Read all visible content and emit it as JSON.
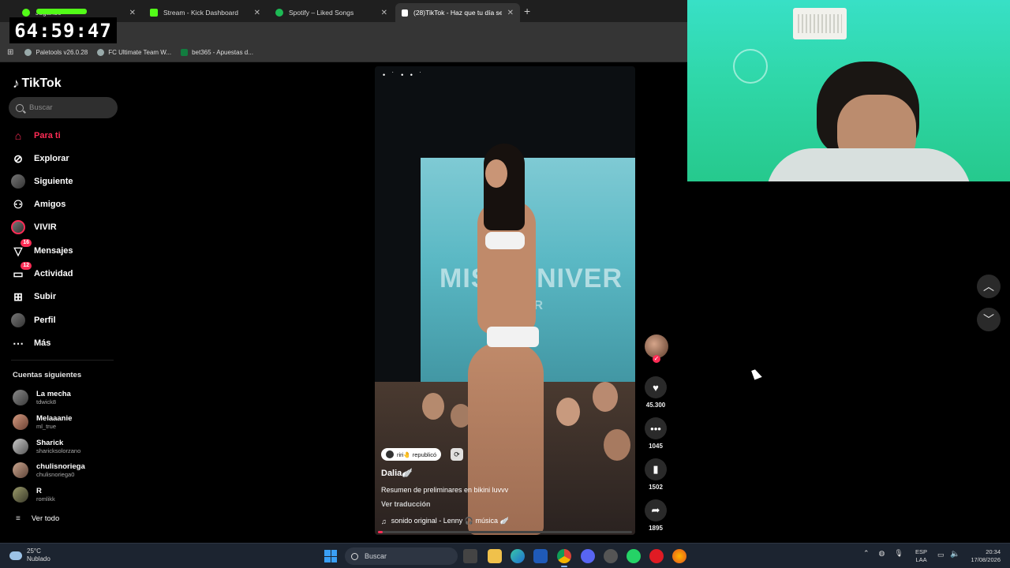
{
  "browser": {
    "tabs": [
      {
        "label": "Jugando",
        "color": "#53fc18",
        "active": false
      },
      {
        "label": "Stream - Kick Dashboard",
        "color": "#53fc18",
        "active": false
      },
      {
        "label": "Spotify – Liked Songs",
        "color": "#1db954",
        "active": false
      },
      {
        "label": "(28)TikTok - Haz que tu día sea",
        "color": "#ffffff",
        "active": true
      }
    ],
    "timer": "64:59:47",
    "bookmarks": [
      {
        "label": "Paletools v26.0.28"
      },
      {
        "label": "FC Ultimate Team W..."
      },
      {
        "label": "bet365 - Apuestas d..."
      }
    ]
  },
  "tiktok": {
    "logo": "TikTok",
    "search_placeholder": "Buscar",
    "nav": [
      {
        "label": "Para ti",
        "icon": "home-icon"
      },
      {
        "label": "Explorar",
        "icon": "compass-icon"
      },
      {
        "label": "Siguiente",
        "icon": "following-icon"
      },
      {
        "label": "Amigos",
        "icon": "friends-icon"
      },
      {
        "label": "VIVIR",
        "icon": "live-icon"
      },
      {
        "label": "Mensajes",
        "icon": "messages-icon",
        "badge": "16"
      },
      {
        "label": "Actividad",
        "icon": "activity-icon",
        "badge": "12"
      },
      {
        "label": "Subir",
        "icon": "upload-icon"
      },
      {
        "label": "Perfil",
        "icon": "profile-icon"
      },
      {
        "label": "Más",
        "icon": "more-icon"
      }
    ],
    "following_title": "Cuentas siguientes",
    "following": [
      {
        "name": "La mecha",
        "handle": "tdwick8"
      },
      {
        "name": "Melaaanie",
        "handle": "ml_true"
      },
      {
        "name": "Sharick",
        "handle": "sharicksolorzano"
      },
      {
        "name": "chulisnoriega",
        "handle": "chulisnoriega0"
      },
      {
        "name": "R",
        "handle": "romlikk"
      }
    ],
    "see_all": "Ver todo",
    "video": {
      "screen_text": "MISS UNIVER",
      "screen_text2": "ADOR",
      "repost_label": "riri🤚 republicó",
      "author": "Dalia🪽",
      "caption": "Resumen de preliminares en bikini luvvv",
      "translate": "Ver traducción",
      "sound": "sonido original - Lenny 🎧 música 🪽",
      "progress": 0.02
    },
    "actions": {
      "likes": "45.300",
      "comments": "1045",
      "saves": "1502",
      "shares": "1895"
    }
  },
  "taskbar": {
    "weather_temp": "25°C",
    "weather_desc": "Nublado",
    "search_placeholder": "Buscar",
    "lang1": "ESP",
    "lang2": "LAA",
    "time": "20:34",
    "date": "17/08/2026"
  }
}
